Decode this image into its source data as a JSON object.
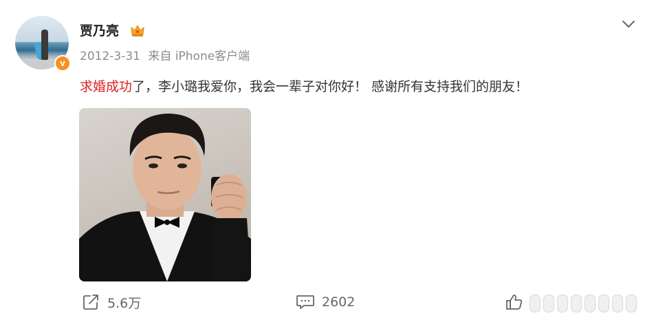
{
  "post": {
    "author": "贾乃亮",
    "date": "2012-3-31",
    "source": "来自 iPhone客户端",
    "text_highlight": "求婚成功",
    "text_rest": "了，李小璐我爱你，我会一辈子对你好！ 感谢所有支持我们的朋友！"
  },
  "actions": {
    "repost": "5.6万",
    "comments": "2602"
  },
  "colors": {
    "highlight": "#e02020",
    "verified_badge": "#f7911e",
    "crown": "#f5a623"
  },
  "icons": [
    "avatar",
    "verified-badge-icon",
    "crown-icon",
    "chevron-down-icon",
    "repost-icon",
    "comment-icon",
    "like-icon"
  ]
}
